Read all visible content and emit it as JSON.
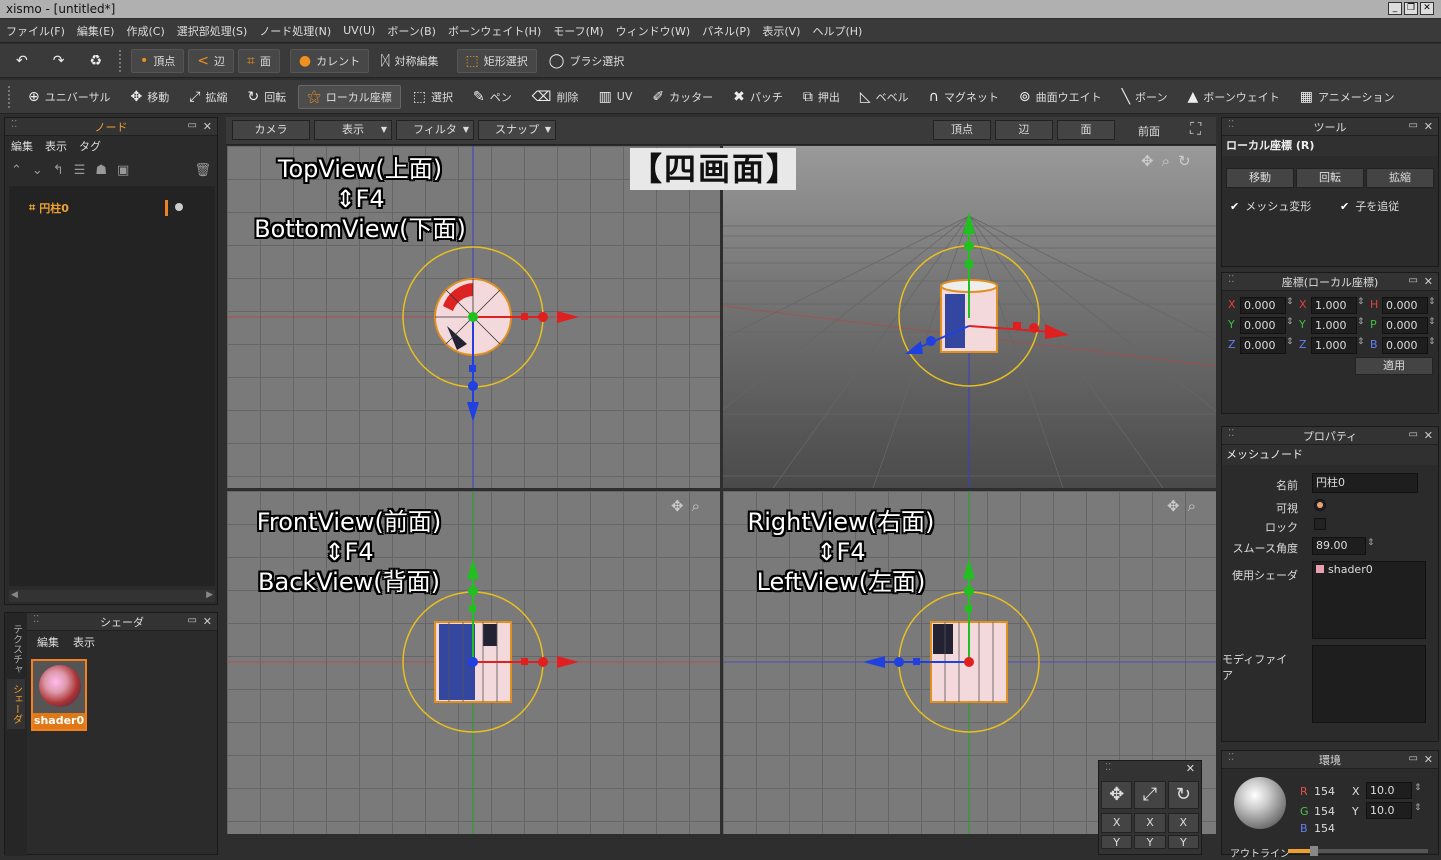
{
  "window": {
    "title": "xismo - [untitled*]"
  },
  "menu": [
    "ファイル(F)",
    "編集(E)",
    "作成(C)",
    "選択部処理(S)",
    "ノード処理(N)",
    "UV(U)",
    "ボーン(B)",
    "ボーンウェイト(H)",
    "モーフ(M)",
    "ウィンドウ(W)",
    "パネル(P)",
    "表示(V)",
    "ヘルプ(H)"
  ],
  "toolbar1": {
    "vertex": "頂点",
    "edge": "辺",
    "face": "面",
    "current": "カレント",
    "symmetry": "対称編集",
    "rect_select": "矩形選択",
    "brush_select": "ブラシ選択"
  },
  "toolbar2": [
    "ユニバーサル",
    "移動",
    "拡縮",
    "回転",
    "ローカル座標",
    "選択",
    "ペン",
    "削除",
    "UV",
    "カッター",
    "パッチ",
    "押出",
    "ベベル",
    "マグネット",
    "曲面ウエイト",
    "ボーン",
    "ボーンウェイト",
    "アニメーション"
  ],
  "node_panel": {
    "title": "ノード",
    "menu": [
      "編集",
      "表示",
      "タグ"
    ],
    "item": "円柱0"
  },
  "shader_panel": {
    "title": "シェーダ",
    "menu": [
      "編集",
      "表示"
    ],
    "item": "shader0",
    "tabs": [
      "テクスチャ",
      "シェーダ"
    ]
  },
  "viewport_bar": {
    "left": [
      "カメラ",
      "表示",
      "フィルタ",
      "スナップ"
    ],
    "right": [
      "頂点",
      "辺",
      "面"
    ],
    "view_name": "前面"
  },
  "annotations": {
    "title": "【四画面】",
    "top": [
      "TopView(上面)",
      "⇕F4",
      "BottomView(下面)"
    ],
    "front": [
      "FrontView(前面)",
      "⇕F4",
      "BackView(背面)"
    ],
    "right": [
      "RightView(右面)",
      "⇕F4",
      "LeftView(左面)"
    ]
  },
  "tool_panel": {
    "title": "ツール",
    "subtitle": "ローカル座標 (R)",
    "buttons": [
      "移動",
      "回転",
      "拡縮"
    ],
    "checks": [
      "メッシュ変形",
      "子を追従"
    ]
  },
  "coord_panel": {
    "title": "座標(ローカル座標)",
    "rows": [
      {
        "a": "X",
        "av": "0.000",
        "b": "X",
        "bv": "1.000",
        "c": "H",
        "cv": "0.000"
      },
      {
        "a": "Y",
        "av": "0.000",
        "b": "Y",
        "bv": "1.000",
        "c": "P",
        "cv": "0.000"
      },
      {
        "a": "Z",
        "av": "0.000",
        "b": "Z",
        "bv": "1.000",
        "c": "B",
        "cv": "0.000"
      }
    ],
    "apply": "適用"
  },
  "property_panel": {
    "title": "プロパティ",
    "section": "メッシュノード",
    "name_label": "名前",
    "name": "円柱0",
    "visible_label": "可視",
    "lock_label": "ロック",
    "smooth_label": "スムース角度",
    "smooth": "89.00",
    "shader_label": "使用シェーダ",
    "shader": "shader0",
    "modifier_label": "モディファイア"
  },
  "env_panel": {
    "title": "環境",
    "r_label": "R",
    "r": "154",
    "g_label": "G",
    "g": "154",
    "b_label": "B",
    "b": "154",
    "x_label": "X",
    "x": "10.0",
    "y_label": "Y",
    "y": "10.0",
    "outline": "アウトライン"
  },
  "nav_widget": {
    "labels": [
      "X",
      "X",
      "X",
      "Y",
      "Y",
      "Y"
    ]
  }
}
